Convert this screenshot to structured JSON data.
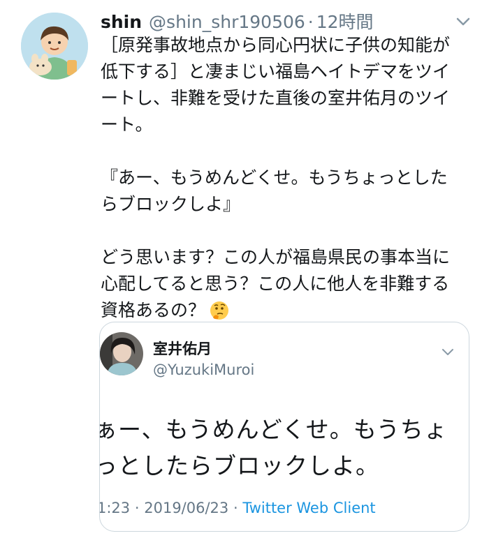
{
  "tweet": {
    "user_name": "shin",
    "handle": "@shin_shr190506",
    "separator": "·",
    "time": "12時間",
    "paragraphs": [
      "［原発事故地点から同心円状に子供の知能が\n低下する］と凄まじい福島ヘイトデマをツイ\nートし、非難を受けた直後の室井佑月のツイ\nート。",
      "『あー、もうめんどくせ。もうちょっとした\nらブロックしよ』"
    ],
    "last_paragraph": "どう思います？この人が福島県民の事本当に\n心配してると思う？この人に他人を非難する\n資格あるの？",
    "emoji": "thinking-face-icon"
  },
  "quoted": {
    "user_name": "室井佑月",
    "handle": "@YuzukiMuroi",
    "text": "ぁー、もうめんどくせ。もうちょ\nっとしたらブロックしよ。",
    "time": "1:23",
    "separator": "·",
    "date": "2019/06/23",
    "separator2": "·",
    "client": "Twitter Web Client"
  },
  "colors": {
    "secondary_text": "#657786",
    "link_blue": "#1b95e0",
    "border": "#ccd6dd"
  }
}
